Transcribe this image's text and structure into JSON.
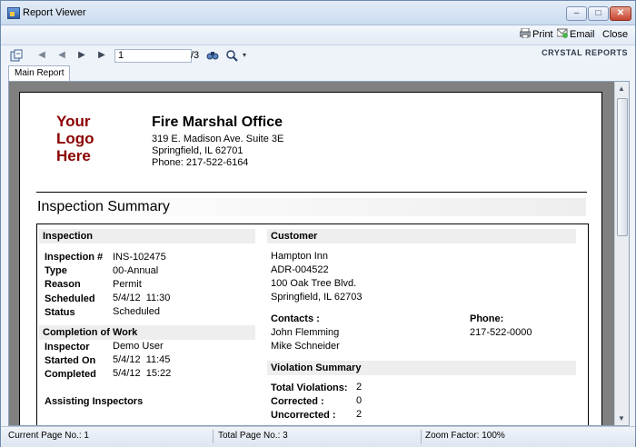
{
  "window": {
    "title": "Report Viewer"
  },
  "menu": {
    "print": "Print",
    "email": "Email",
    "close": "Close"
  },
  "toolbar": {
    "page_value": "1",
    "page_total": "/3",
    "brand": "CRYSTAL REPORTS"
  },
  "tabs": [
    "Main Report"
  ],
  "report": {
    "logo_lines": [
      "Your",
      "Logo",
      "Here"
    ],
    "office_name": "Fire Marshal Office",
    "address_lines": [
      "319 E. Madison Ave. Suite 3E",
      "Springfield, IL 62701",
      "Phone: 217-522-6164"
    ],
    "summary_title": "Inspection Summary",
    "inspection": {
      "heading": "Inspection",
      "rows": [
        {
          "label": "Inspection #",
          "value": "INS-102475"
        },
        {
          "label": "Type",
          "value": "00-Annual"
        },
        {
          "label": "Reason",
          "value": "Permit"
        },
        {
          "label": "Scheduled",
          "value": "5/4/12  11:30"
        },
        {
          "label": "Status",
          "value": "Scheduled"
        }
      ]
    },
    "completion": {
      "heading": "Completion of Work",
      "rows": [
        {
          "label": "Inspector",
          "value": "Demo User"
        },
        {
          "label": "Started On",
          "value": "5/4/12  11:45"
        },
        {
          "label": "Completed",
          "value": "5/4/12  15:22"
        }
      ]
    },
    "assisting_label": "Assisting Inspectors",
    "customer": {
      "heading": "Customer",
      "lines": [
        "Hampton Inn",
        "ADR-004522",
        "100 Oak Tree Blvd.",
        "Springfield, IL 62703"
      ],
      "contacts_label": "Contacts :",
      "contacts": [
        "John Flemming",
        "Mike Schneider"
      ],
      "phone_label": "Phone:",
      "phone": "217-522-0000"
    },
    "violation": {
      "heading": "Violation Summary",
      "rows": [
        {
          "label": "Total Violations:",
          "value": "2"
        },
        {
          "label": "Corrected :",
          "value": "0"
        },
        {
          "label": "Uncorrected :",
          "value": "2"
        }
      ]
    }
  },
  "status": {
    "current_page": "Current Page No.: 1",
    "total_page": "Total Page No.: 3",
    "zoom": "Zoom Factor: 100%"
  }
}
